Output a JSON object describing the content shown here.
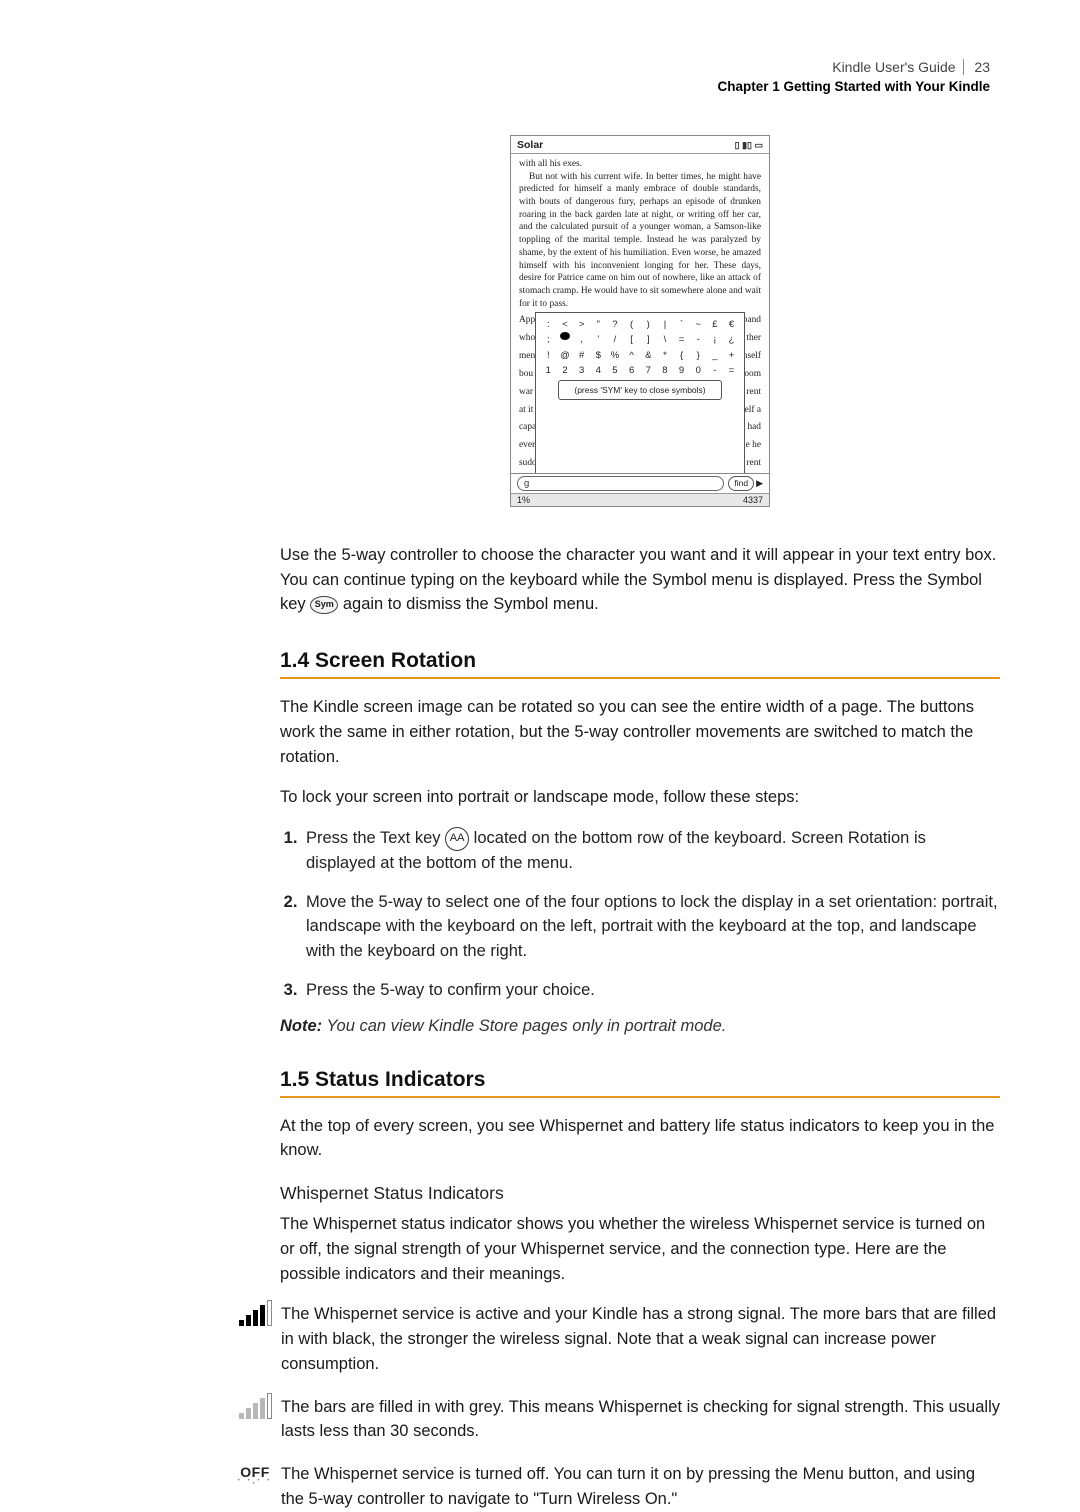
{
  "header": {
    "guide_title": "Kindle User's Guide",
    "page_number": "23",
    "chapter_line": "Chapter 1 Getting Started with Your Kindle"
  },
  "figure": {
    "topbar_title": "Solar",
    "topbar_status": "▯ ▮▯ ▭",
    "para_firstline": "with all his exes.",
    "para_main": "But not with his current wife. In better times, he might have predicted for himself a manly embrace of double standards, with bouts of dangerous fury, perhaps an episode of drunken roaring in the back garden late at night, or writing off her car, and the calculated pursuit of a younger woman, a Samson-like toppling of the marital temple. Instead he was paralyzed by shame, by the extent of his humiliation. Even worse, he amazed himself with his inconvenient longing for her. These days, desire for Patrice came on him out of nowhere, like an attack of stomach cramp. He would have to sit somewhere alone and wait for it to pass.",
    "behind_left": [
      "App",
      "who",
      "men",
      "bou",
      "war",
      "at it",
      "capa",
      "ever",
      "sudd"
    ],
    "behind_right": [
      "band",
      "ther",
      "nself",
      "oom",
      "rent",
      "elf a",
      "had",
      "e he",
      "rent"
    ],
    "sym_row1": [
      ":",
      "<",
      ">",
      "\"",
      "?",
      "(",
      ")",
      "|",
      "`",
      "~",
      "£",
      "€"
    ],
    "sym_row2": [
      ";",
      "●",
      ",",
      "'",
      "/",
      "[",
      "]",
      "\\",
      "=",
      "-",
      "¡",
      "¿"
    ],
    "sym_row3": [
      "!",
      "@",
      "#",
      "$",
      "%",
      "^",
      "&",
      "*",
      "{",
      "}",
      "_",
      "+"
    ],
    "sym_row4": [
      "1",
      "2",
      "3",
      "4",
      "5",
      "6",
      "7",
      "8",
      "9",
      "0",
      "-",
      "="
    ],
    "sym_hint": "(press 'SYM' key to close symbols)",
    "search_value": "g",
    "find_label": "find",
    "bottom_left": "1%",
    "bottom_right": "4337"
  },
  "para_below_figure_1": "Use the 5-way controller to choose the character you want and it will appear in your text entry box. You can continue typing on the keyboard while the Symbol menu is displayed. Press the Symbol key ",
  "sym_key_label": "Sym",
  "para_below_figure_2": " again to dismiss the Symbol menu.",
  "section_14": {
    "heading": "1.4 Screen Rotation",
    "para1": "The Kindle screen image can be rotated so you can see the entire width of a page. The buttons work the same in either rotation, but the 5-way controller movements are switched to match the rotation.",
    "para2": "To lock your screen into portrait or landscape mode, follow these steps:",
    "steps": [
      {
        "pre": "Press the Text key ",
        "key": "AA",
        "post": " located on the bottom row of the keyboard. Screen Rotation is displayed at the bottom of the menu."
      },
      {
        "text": "Move the 5-way to select one of the four options to lock the display in a set orientation: portrait, landscape with the keyboard on the left, portrait with the keyboard at the top, and landscape with the keyboard on the right."
      },
      {
        "text": "Press the 5-way to confirm your choice."
      }
    ],
    "note_label": "Note:",
    "note_text": " You can view Kindle Store pages only in portrait mode."
  },
  "section_15": {
    "heading": "1.5 Status Indicators",
    "para1": "At the top of every screen, you see Whispernet and battery life status indicators to keep you in the know.",
    "subhead": "Whispernet Status Indicators",
    "para2": "The Whispernet status indicator shows you whether the wireless Whispernet service is turned on or off, the signal strength of your Whispernet service, and the connection type. Here are the possible indicators and their meanings.",
    "indicators": [
      {
        "icon": "bars-strong",
        "text": "The Whispernet service is active and your Kindle has a strong signal. The more bars that are filled in with black, the stronger the wireless signal. Note that a weak signal can increase power consumption."
      },
      {
        "icon": "bars-grey",
        "text": "The bars are filled in with grey. This means Whispernet is checking for signal strength. This usually lasts less than 30 seconds."
      },
      {
        "icon": "off",
        "off_label": "OFF",
        "text": "The Whispernet service is turned off. You can turn it on by pressing the Menu button, and using the 5-way controller to navigate to \"Turn Wireless On.\""
      }
    ]
  }
}
